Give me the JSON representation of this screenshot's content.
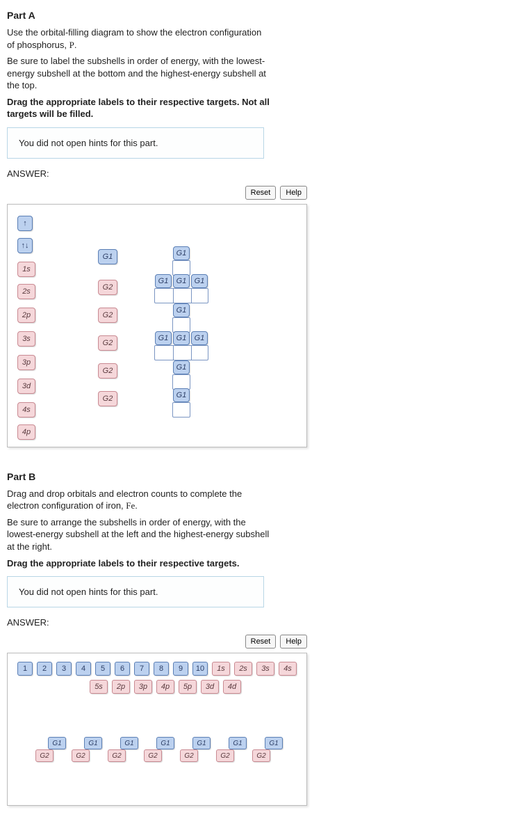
{
  "partA": {
    "title": "Part A",
    "p1a": "Use the orbital-filling diagram to show the electron configuration of phosphorus, ",
    "p1sym": "P",
    "p1b": ".",
    "p2": "Be sure to label the subshells in order of energy, with the lowest-energy subshell at the bottom and the highest-energy subshell at the top.",
    "p3": "Drag the appropriate labels to their respective targets. Not all targets will be filled.",
    "hint": "You did not open hints for this part.",
    "answer": "ANSWER:",
    "reset": "Reset",
    "help": "Help",
    "arrows": {
      "up": "↑",
      "updown": "↑↓"
    },
    "subshells": [
      "1s",
      "2s",
      "2p",
      "3s",
      "3p",
      "3d",
      "4s",
      "4p"
    ],
    "g1": "G1",
    "g2": "G2"
  },
  "partB": {
    "title": "Part B",
    "p1a": "Drag and drop orbitals and electron counts to complete the electron configuration of iron, ",
    "p1sym": "Fe",
    "p1b": ".",
    "p2": "Be sure to arrange the subshells in order of energy, with the lowest-energy subshell at the left and the highest-energy subshell at the right.",
    "p3": "Drag the appropriate labels to their respective targets.",
    "hint": "You did not open hints for this part.",
    "answer": "ANSWER:",
    "reset": "Reset",
    "help": "Help",
    "nums": [
      "1",
      "2",
      "3",
      "4",
      "5",
      "6",
      "7",
      "8",
      "9",
      "10"
    ],
    "orbs_row1": [
      "1s",
      "2s",
      "3s",
      "4s"
    ],
    "orbs_row2": [
      "5s",
      "2p",
      "3p",
      "4p",
      "5p",
      "3d",
      "4d"
    ],
    "g1": "G1",
    "g2": "G2"
  }
}
